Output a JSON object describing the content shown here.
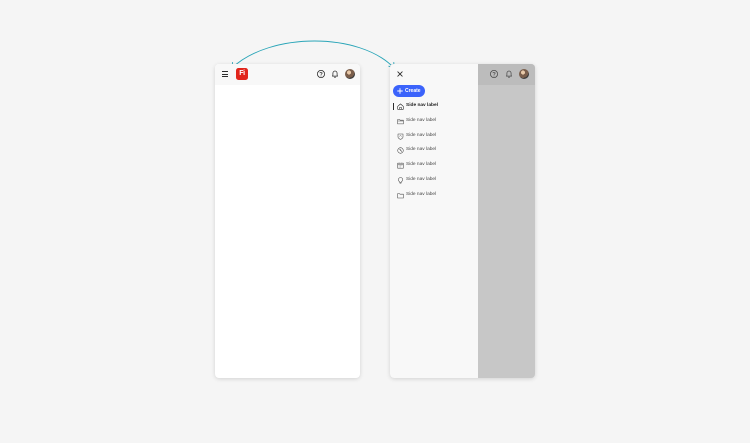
{
  "left_screen": {
    "logo_text": "Fi",
    "icons": {
      "menu": "hamburger-icon",
      "help": "help-icon",
      "notifications": "bell-icon",
      "avatar": "avatar"
    }
  },
  "right_screen": {
    "create_label": "Create",
    "icons": {
      "close": "close-icon",
      "create": "plus-icon",
      "help": "help-icon",
      "notifications": "bell-icon",
      "avatar": "avatar"
    },
    "nav_items": [
      {
        "label": "Side nav label",
        "icon": "home-icon",
        "active": true
      },
      {
        "label": "Side nav label",
        "icon": "folder-icon",
        "active": false
      },
      {
        "label": "Side nav label",
        "icon": "shield-icon",
        "active": false
      },
      {
        "label": "Side nav label",
        "icon": "clock-icon",
        "active": false
      },
      {
        "label": "Side nav label",
        "icon": "calendar-icon",
        "active": false
      },
      {
        "label": "Side nav label",
        "icon": "lightbulb-icon",
        "active": false
      },
      {
        "label": "Side nav label",
        "icon": "archive-folder-icon",
        "active": false
      }
    ]
  },
  "colors": {
    "background": "#f5f5f5",
    "surface": "#ffffff",
    "logo_red": "#e1251b",
    "create_blue": "#3b63fb",
    "arrow_teal": "#2aa5b8",
    "overlay_gray": "#c7c7c7"
  }
}
